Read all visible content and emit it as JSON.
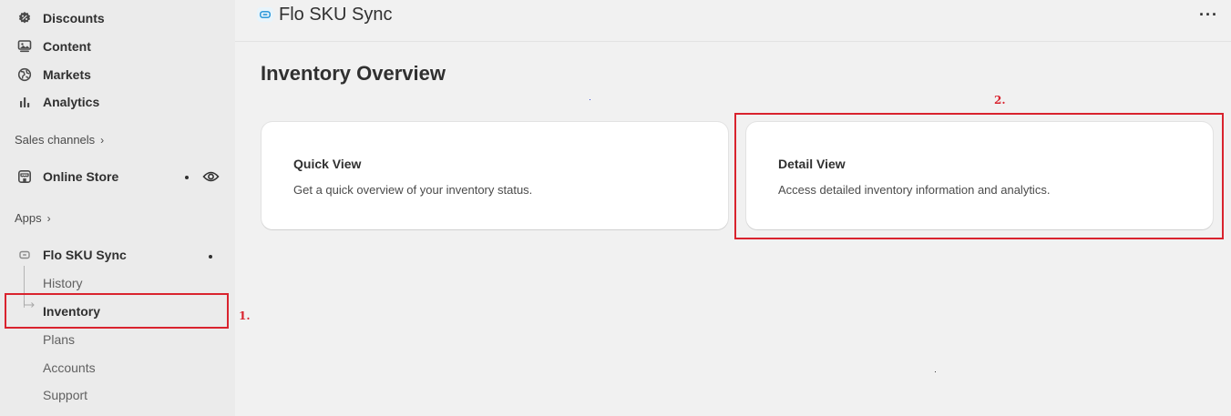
{
  "sidebar": {
    "items": [
      {
        "label": "Discounts",
        "icon": "discount-icon"
      },
      {
        "label": "Content",
        "icon": "content-icon"
      },
      {
        "label": "Markets",
        "icon": "globe-icon"
      },
      {
        "label": "Analytics",
        "icon": "bar-chart-icon"
      }
    ],
    "sales_channels": "Sales channels",
    "online_store": "Online Store",
    "apps": "Apps",
    "app_name": "Flo SKU Sync",
    "sub_items": [
      "History",
      "Inventory",
      "Plans",
      "Accounts",
      "Support"
    ],
    "active_sub_item": "Inventory"
  },
  "header": {
    "app_title": "Flo SKU Sync",
    "more_label": "···"
  },
  "main": {
    "page_title": "Inventory Overview",
    "cards": [
      {
        "title": "Quick View",
        "description": "Get a quick overview of your inventory status."
      },
      {
        "title": "Detail View",
        "description": "Access detailed inventory information and analytics."
      }
    ]
  },
  "annotations": {
    "label_1": "1.",
    "label_2": "2.",
    "color": "#d9232e"
  }
}
